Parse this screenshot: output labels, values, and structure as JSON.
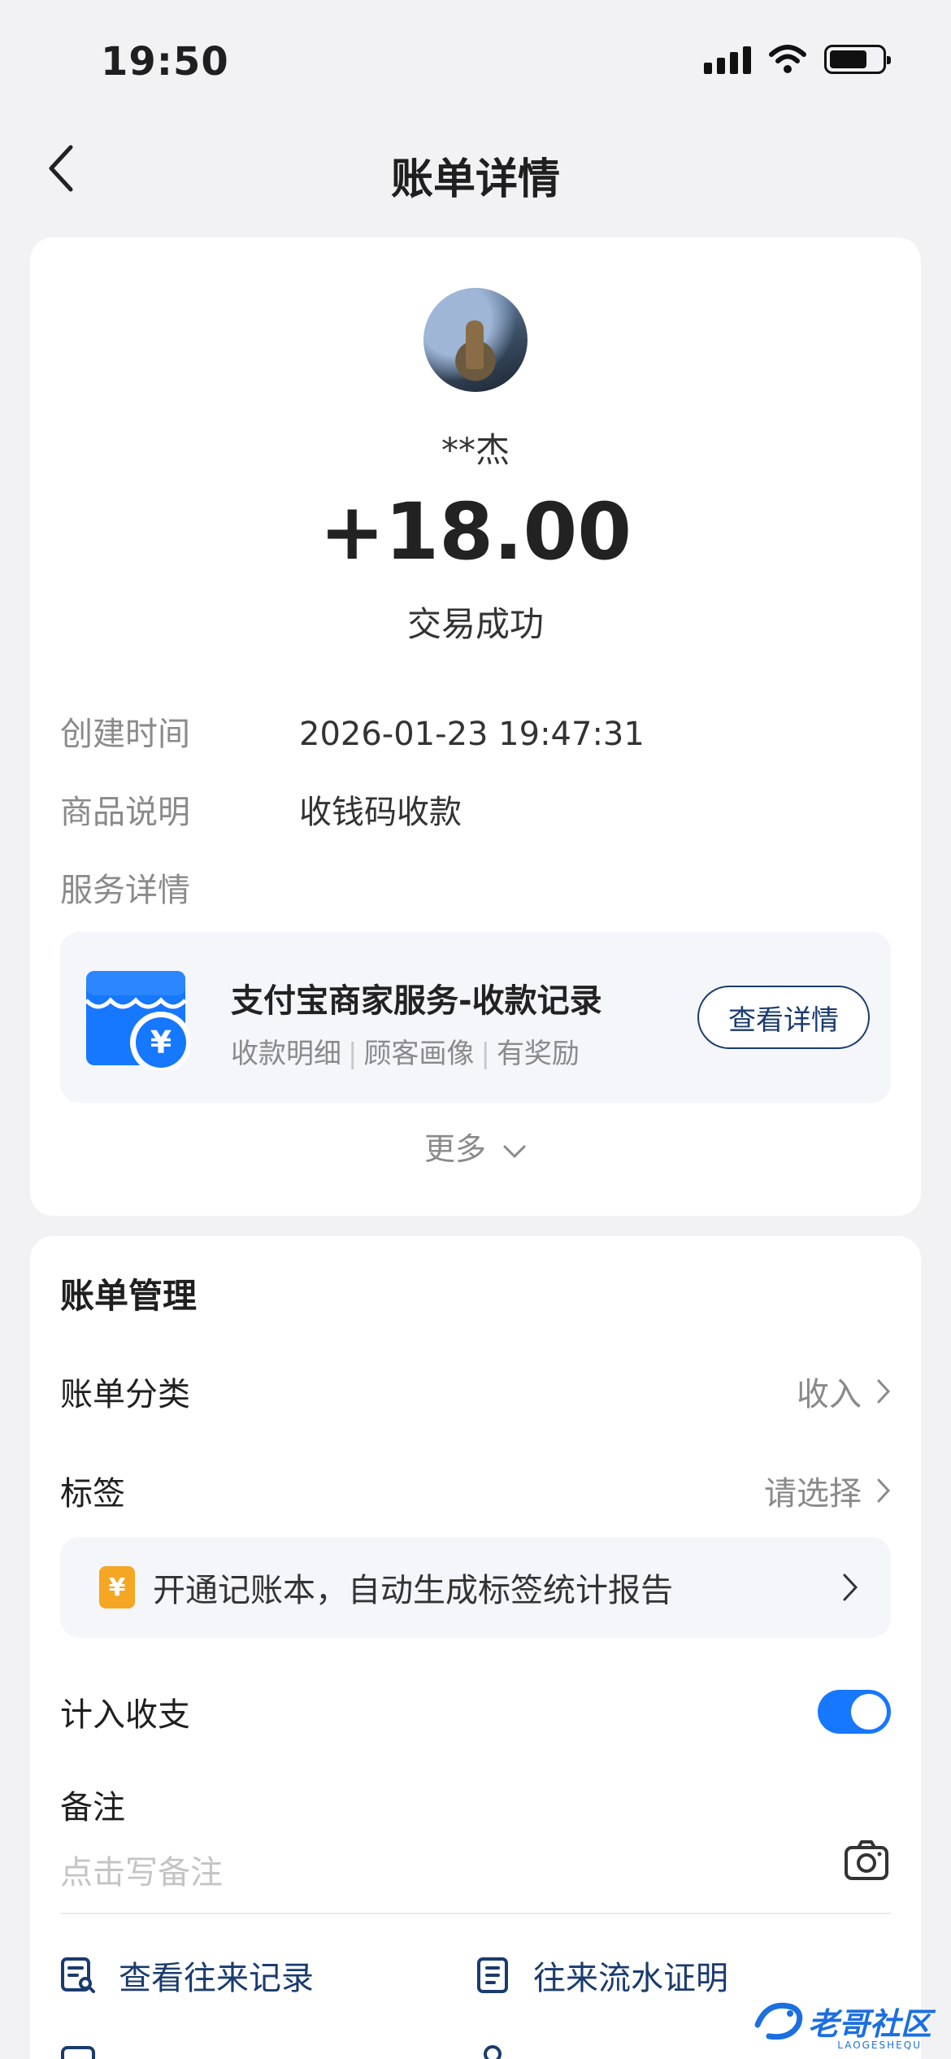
{
  "status_bar": {
    "time": "19:50"
  },
  "nav": {
    "title": "账单详情"
  },
  "transaction": {
    "payer": "**杰",
    "amount": "+18.00",
    "status": "交易成功"
  },
  "details": [
    {
      "label": "创建时间",
      "value": "2026-01-23 19:47:31"
    },
    {
      "label": "商品说明",
      "value": "收钱码收款"
    },
    {
      "label": "服务详情",
      "value": ""
    }
  ],
  "service": {
    "title": "支付宝商家服务-收款记录",
    "tags": [
      "收款明细",
      "顾客画像",
      "有奖励"
    ],
    "button": "查看详情",
    "currency_symbol": "¥"
  },
  "more": {
    "label": "更多"
  },
  "management": {
    "title": "账单管理",
    "category": {
      "label": "账单分类",
      "value": "收入"
    },
    "tag": {
      "label": "标签",
      "value": "请选择"
    },
    "promo": {
      "icon_text": "¥",
      "text": "开通记账本，自动生成标签统计报告"
    },
    "include": {
      "label": "计入收支",
      "enabled": true
    },
    "note": {
      "label": "备注",
      "placeholder": "点击写备注"
    }
  },
  "links": {
    "history": "查看往来记录",
    "statement": "往来流水证明"
  },
  "watermark": {
    "text": "老哥社区",
    "sub": "LAOGESHEQU"
  },
  "colors": {
    "accent": "#1677ff",
    "link": "#1a3b6e",
    "background": "#f2f2f4"
  }
}
